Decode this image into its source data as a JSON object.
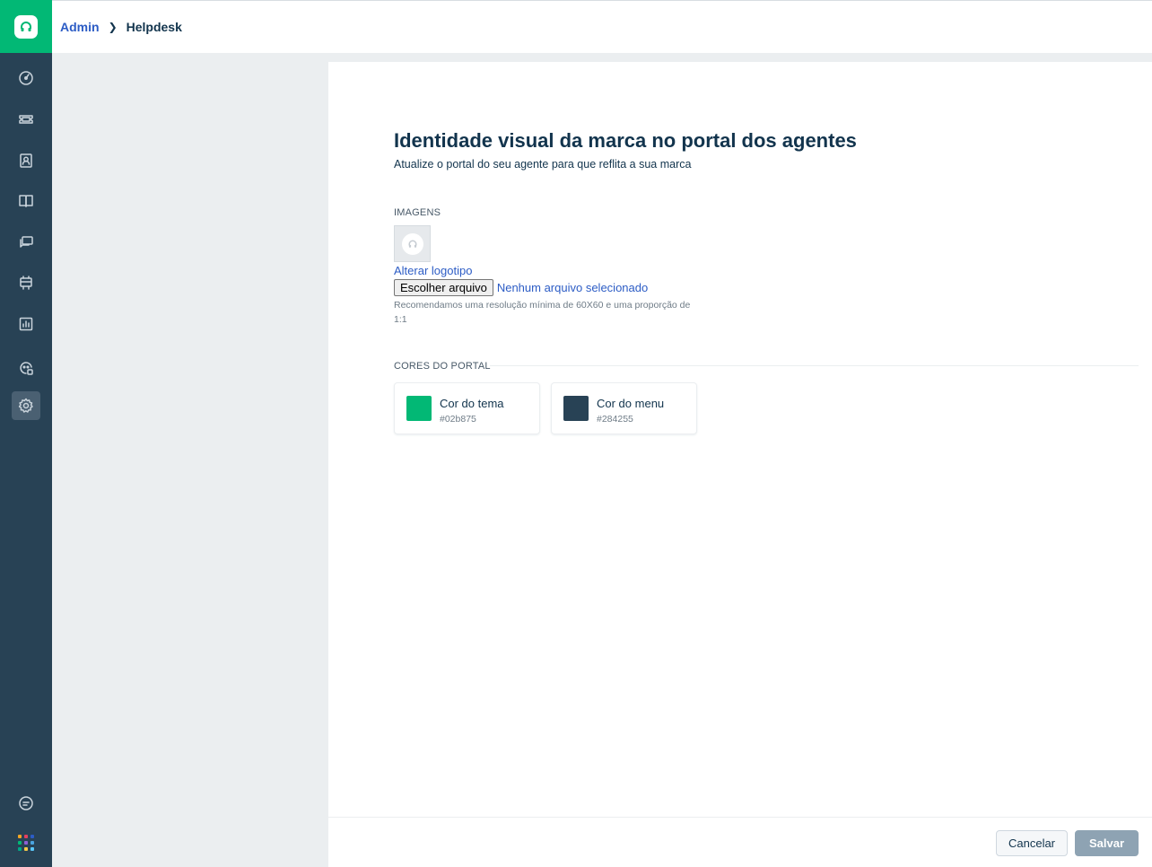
{
  "app": {
    "brand_color": "#02b875",
    "menu_color": "#284255"
  },
  "sidebar": {
    "items": [
      {
        "name": "dashboard-icon",
        "active": false
      },
      {
        "name": "tickets-icon",
        "active": false
      },
      {
        "name": "contacts-icon",
        "active": false
      },
      {
        "name": "solutions-icon",
        "active": false
      },
      {
        "name": "forums-icon",
        "active": false
      },
      {
        "name": "assets-icon",
        "active": false
      },
      {
        "name": "reports-icon",
        "active": false
      },
      {
        "name": "bot-icon",
        "active": false
      },
      {
        "name": "admin-gear-icon",
        "active": true
      }
    ],
    "bottom": [
      "chat-icon",
      "apps-grid-icon"
    ]
  },
  "breadcrumb": {
    "parent": "Admin",
    "current": "Helpdesk"
  },
  "page": {
    "title": "Identidade visual da marca no portal dos agentes",
    "subtitle": "Atualize o portal do seu agente para que reflita a sua marca"
  },
  "images_section": {
    "label": "IMAGENS",
    "change_logo": "Alterar logotipo",
    "file_button": "Escolher arquivo",
    "file_status": "Nenhum arquivo selecionado",
    "hint": "Recomendamos uma resolução mínima de 60X60 e uma proporção de 1:1"
  },
  "colors_section": {
    "label": "CORES DO PORTAL",
    "cards": [
      {
        "name": "Cor do tema",
        "hex": "#02b875",
        "color": "#02b875"
      },
      {
        "name": "Cor do menu",
        "hex": "#284255",
        "color": "#284255"
      }
    ]
  },
  "footer": {
    "cancel": "Cancelar",
    "save": "Salvar"
  }
}
